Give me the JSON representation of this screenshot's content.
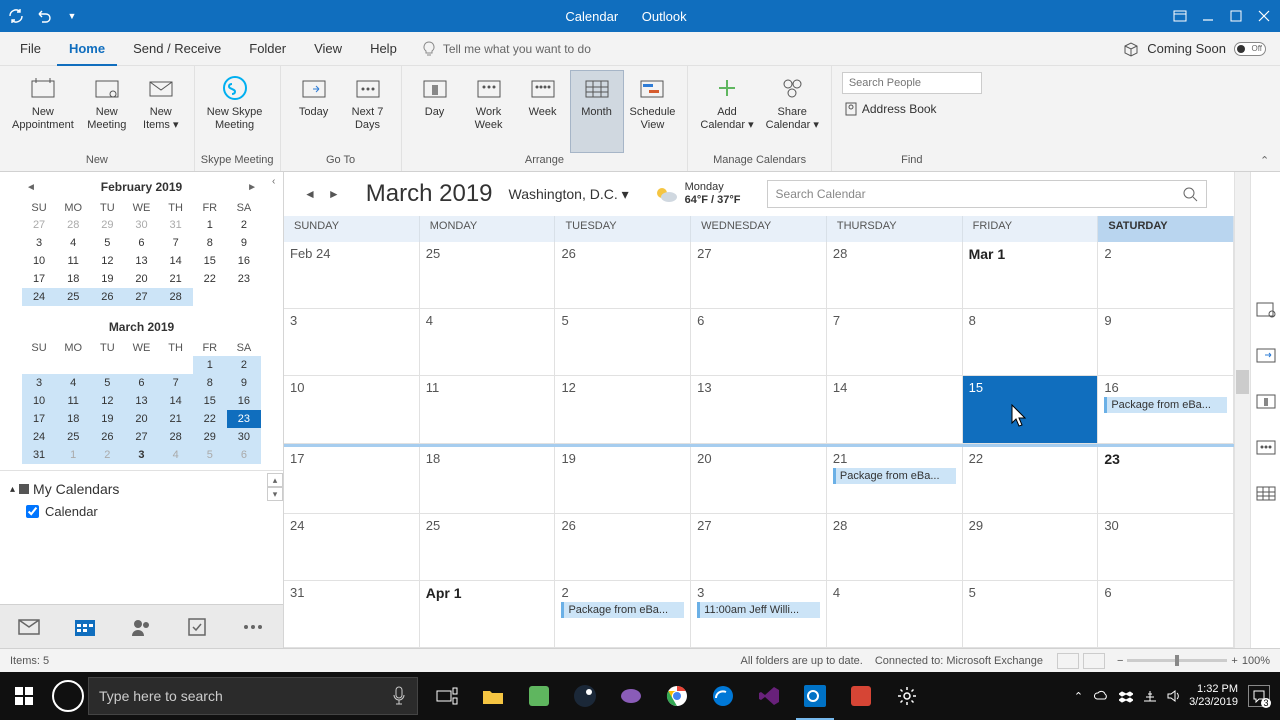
{
  "titlebar": {
    "app_area": "Calendar",
    "app_name": "Outlook"
  },
  "menus": {
    "file": "File",
    "home": "Home",
    "sendreceive": "Send / Receive",
    "folder": "Folder",
    "view": "View",
    "help": "Help",
    "tellme": "Tell me what you want to do",
    "coming": "Coming Soon",
    "toggle": "Off"
  },
  "ribbon": {
    "new_appt": "New\nAppointment",
    "new_meeting": "New\nMeeting",
    "new_items": "New\nItems ▾",
    "skype": "New Skype\nMeeting",
    "today": "Today",
    "next7": "Next 7\nDays",
    "day": "Day",
    "workweek": "Work\nWeek",
    "week": "Week",
    "month": "Month",
    "schedule": "Schedule\nView",
    "addcal": "Add\nCalendar ▾",
    "sharecal": "Share\nCalendar ▾",
    "searchppl": "Search People",
    "addrbook": "Address Book",
    "grp_new": "New",
    "grp_skype": "Skype Meeting",
    "grp_goto": "Go To",
    "grp_arrange": "Arrange",
    "grp_manage": "Manage Calendars",
    "grp_find": "Find"
  },
  "nav": {
    "feb": {
      "title": "February 2019",
      "dow": [
        "SU",
        "MO",
        "TU",
        "WE",
        "TH",
        "FR",
        "SA"
      ],
      "rows": [
        [
          "27",
          "28",
          "29",
          "30",
          "31",
          "1",
          "2"
        ],
        [
          "3",
          "4",
          "5",
          "6",
          "7",
          "8",
          "9"
        ],
        [
          "10",
          "11",
          "12",
          "13",
          "14",
          "15",
          "16"
        ],
        [
          "17",
          "18",
          "19",
          "20",
          "21",
          "22",
          "23"
        ],
        [
          "24",
          "25",
          "26",
          "27",
          "28",
          "",
          ""
        ]
      ],
      "dim": [
        [
          0,
          0
        ],
        [
          0,
          1
        ],
        [
          0,
          2
        ],
        [
          0,
          3
        ],
        [
          0,
          4
        ]
      ],
      "hl": [
        [
          4,
          0
        ],
        [
          4,
          1
        ],
        [
          4,
          2
        ],
        [
          4,
          3
        ],
        [
          4,
          4
        ]
      ]
    },
    "mar": {
      "title": "March 2019",
      "dow": [
        "SU",
        "MO",
        "TU",
        "WE",
        "TH",
        "FR",
        "SA"
      ],
      "rows": [
        [
          "",
          "",
          "",
          "",
          "",
          "1",
          "2"
        ],
        [
          "3",
          "4",
          "5",
          "6",
          "7",
          "8",
          "9"
        ],
        [
          "10",
          "11",
          "12",
          "13",
          "14",
          "15",
          "16"
        ],
        [
          "17",
          "18",
          "19",
          "20",
          "21",
          "22",
          "23"
        ],
        [
          "24",
          "25",
          "26",
          "27",
          "28",
          "29",
          "30"
        ],
        [
          "31",
          "1",
          "2",
          "3",
          "4",
          "5",
          "6"
        ]
      ],
      "dim": [
        [
          5,
          1
        ],
        [
          5,
          2
        ],
        [
          5,
          4
        ],
        [
          5,
          5
        ],
        [
          5,
          6
        ]
      ],
      "bold": [
        [
          5,
          3
        ]
      ],
      "hl_rows": [
        0,
        1,
        2,
        3,
        4,
        5
      ],
      "hl_except": [
        [
          3,
          6
        ]
      ],
      "today": [
        3,
        6
      ]
    },
    "mycal": "My Calendars",
    "cal_item": "Calendar"
  },
  "calhdr": {
    "title": "March 2019",
    "location": "Washington,  D.C. ▾",
    "weather_day": "Monday",
    "weather_temp": "64°F / 37°F",
    "search_ph": "Search Calendar"
  },
  "dayheaders": [
    "SUNDAY",
    "MONDAY",
    "TUESDAY",
    "WEDNESDAY",
    "THURSDAY",
    "FRIDAY",
    "SATURDAY"
  ],
  "weeks": [
    [
      {
        "d": "Feb 24"
      },
      {
        "d": "25"
      },
      {
        "d": "26"
      },
      {
        "d": "27"
      },
      {
        "d": "28"
      },
      {
        "d": "Mar 1",
        "bold": true
      },
      {
        "d": "2"
      }
    ],
    [
      {
        "d": "3"
      },
      {
        "d": "4"
      },
      {
        "d": "5"
      },
      {
        "d": "6"
      },
      {
        "d": "7"
      },
      {
        "d": "8"
      },
      {
        "d": "9"
      }
    ],
    [
      {
        "d": "10"
      },
      {
        "d": "11"
      },
      {
        "d": "12"
      },
      {
        "d": "13"
      },
      {
        "d": "14"
      },
      {
        "d": "15",
        "selected": true
      },
      {
        "d": "16",
        "evt": "Package from eBa..."
      }
    ],
    [
      {
        "d": "17"
      },
      {
        "d": "18"
      },
      {
        "d": "19"
      },
      {
        "d": "20"
      },
      {
        "d": "21",
        "evt": "Package from eBa..."
      },
      {
        "d": "22"
      },
      {
        "d": "23",
        "bold": true
      }
    ],
    [
      {
        "d": "24"
      },
      {
        "d": "25"
      },
      {
        "d": "26"
      },
      {
        "d": "27"
      },
      {
        "d": "28"
      },
      {
        "d": "29"
      },
      {
        "d": "30"
      }
    ],
    [
      {
        "d": "31"
      },
      {
        "d": "Apr 1",
        "bold": true
      },
      {
        "d": "2",
        "evt": "Package from eBa..."
      },
      {
        "d": "3",
        "evt": "11:00am Jeff Willi..."
      },
      {
        "d": "4"
      },
      {
        "d": "5"
      },
      {
        "d": "6"
      }
    ]
  ],
  "status": {
    "items": "Items: 5",
    "sync": "All folders are up to date.",
    "conn": "Connected to: Microsoft Exchange",
    "zoom": "100%"
  },
  "taskbar": {
    "search_ph": "Type here to search",
    "time": "1:32 PM",
    "date": "3/23/2019",
    "notif": "3"
  }
}
